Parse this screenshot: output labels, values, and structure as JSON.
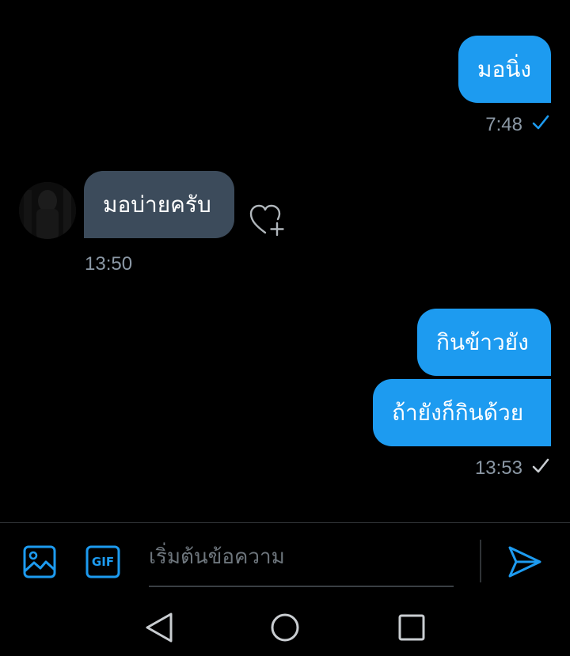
{
  "colors": {
    "background": "#000000",
    "outgoing_bubble": "#1d9bf0",
    "incoming_bubble": "#3c4b5b",
    "meta_text": "#8b98a5",
    "accent": "#1d9bf0"
  },
  "messages": [
    {
      "id": "m1",
      "direction": "outgoing",
      "text": "มอนิ่ง"
    },
    {
      "id": "m2",
      "direction": "incoming",
      "text": "มอบ่ายครับ"
    },
    {
      "id": "m3",
      "direction": "outgoing",
      "text": "กินข้าวยัง"
    },
    {
      "id": "m4",
      "direction": "outgoing",
      "text": "ถ้ายังก็กินด้วย"
    }
  ],
  "timestamps": {
    "t1": "7:48",
    "t2": "13:50",
    "t3": "13:53"
  },
  "composer": {
    "placeholder": "เริ่มต้นข้อความ",
    "value": "",
    "image_icon": "image-icon",
    "gif_icon": "gif-icon",
    "gif_label": "GIF",
    "send_icon": "send-icon"
  },
  "reaction": {
    "icon": "heart-plus-icon"
  },
  "navbar": {
    "back_icon": "back-triangle-icon",
    "home_icon": "home-circle-icon",
    "recents_icon": "recents-square-icon"
  }
}
